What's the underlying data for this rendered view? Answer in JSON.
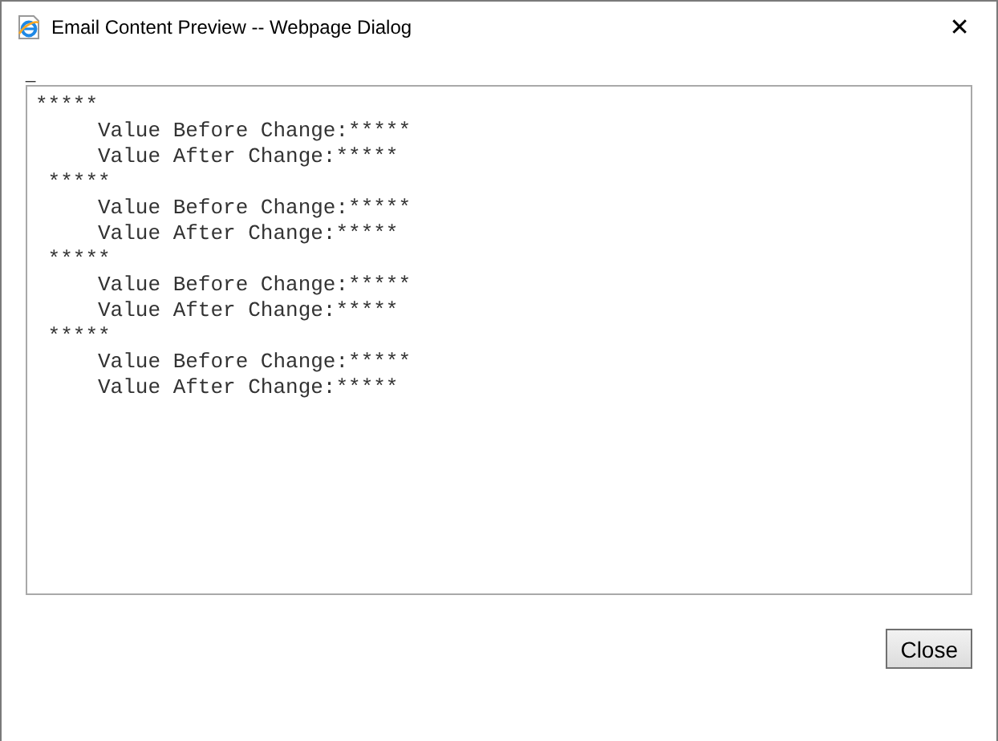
{
  "window": {
    "title": "Email Content Preview -- Webpage Dialog",
    "close_glyph": "✕"
  },
  "marker": "_",
  "content_lines": [
    "*****",
    "     Value Before Change:*****",
    "     Value After Change:*****",
    " *****",
    "     Value Before Change:*****",
    "     Value After Change:*****",
    " *****",
    "     Value Before Change:*****",
    "     Value After Change:*****",
    " *****",
    "     Value Before Change:*****",
    "     Value After Change:*****"
  ],
  "buttons": [
    "Close"
  ]
}
